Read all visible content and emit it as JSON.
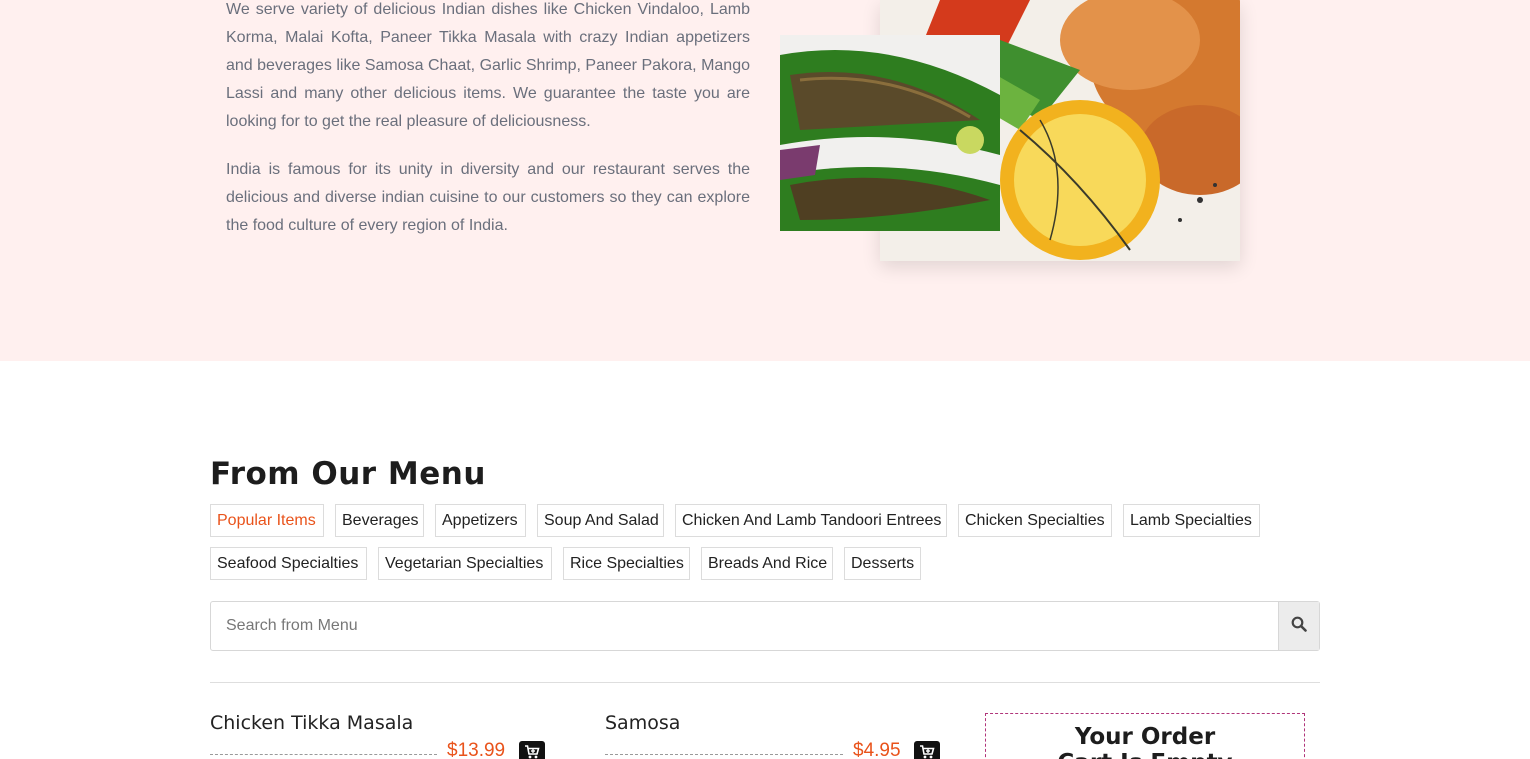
{
  "about": {
    "paragraphs": [
      "We serve variety of delicious Indian dishes like Chicken Vindaloo, Lamb Korma, Malai Kofta, Paneer Tikka Masala with crazy Indian appetizers and beverages like Samosa Chaat, Garlic Shrimp, Paneer Pakora, Mango Lassi and many other delicious items. We guarantee the taste you are looking for to get the real pleasure of deliciousness.",
      "India is famous for its unity in diversity and our restaurant serves the delicious and diverse indian cuisine to our customers so they can explore the food culture of every region of India."
    ]
  },
  "menu": {
    "title": "From Our Menu",
    "tabs": [
      "Popular Items",
      "Beverages",
      "Appetizers",
      "Soup And Salad",
      "Chicken And Lamb Tandoori Entrees",
      "Chicken Specialties",
      "Lamb Specialties",
      "Seafood Specialties",
      "Vegetarian Specialties",
      "Rice Specialties",
      "Breads And Rice",
      "Desserts"
    ],
    "active_tab": "Popular Items",
    "search": {
      "placeholder": "Search from Menu",
      "value": "",
      "icon": "search-icon"
    },
    "items": [
      {
        "name": "Chicken Tikka Masala",
        "price": "$13.99",
        "icon": "cart-icon"
      },
      {
        "name": "Samosa",
        "price": "$4.95",
        "icon": "cart-icon"
      }
    ]
  },
  "order": {
    "title_line1": "Your Order",
    "title_line2": "Cart Is Empty"
  },
  "colors": {
    "accent": "#e9531b",
    "about_bg": "#fff0ef",
    "order_border": "#b0357a"
  }
}
